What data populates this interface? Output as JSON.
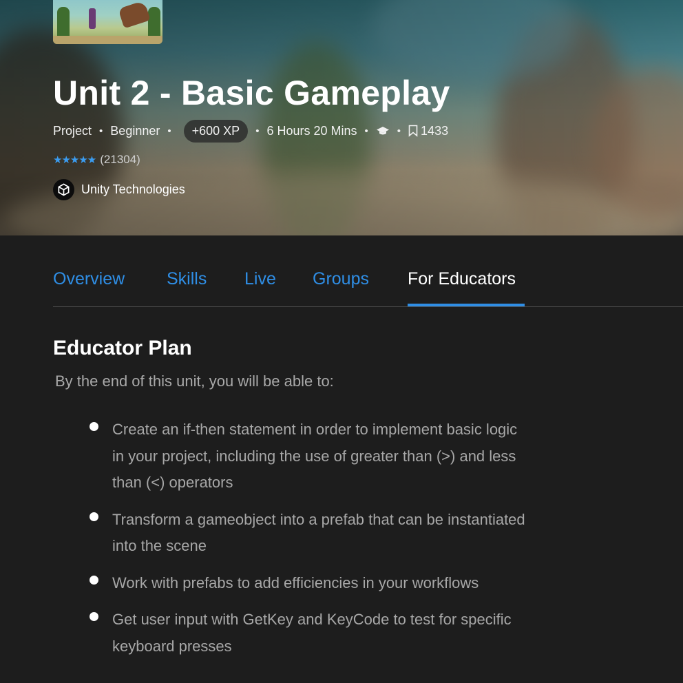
{
  "hero": {
    "title": "Unit 2 - Basic Gameplay",
    "meta": {
      "type": "Project",
      "level": "Beginner",
      "xp": "+600 XP",
      "duration": "6 Hours 20 Mins",
      "educator_icon": "graduation-cap-icon",
      "bookmark_count": "1433"
    },
    "rating": {
      "stars": "★★★★★",
      "value": 4.5,
      "count": "(21304)"
    },
    "author": {
      "name": "Unity Technologies",
      "icon": "unity-logo-icon"
    }
  },
  "tabs": [
    {
      "label": "Overview",
      "active": false
    },
    {
      "label": "Skills",
      "active": false
    },
    {
      "label": "Live",
      "active": false
    },
    {
      "label": "Groups",
      "active": false
    },
    {
      "label": "For Educators",
      "active": true
    }
  ],
  "content": {
    "heading": "Educator Plan",
    "intro": "By the end of this unit, you will be able to:",
    "items": [
      "Create an if-then statement in order to implement basic logic in your project, including the use of greater than (>) and less than (<) operators",
      "Transform a gameobject into a prefab that can be instantiated into the scene",
      "Work with prefabs to add efficiencies in your workflows",
      "Get user input with GetKey and KeyCode to test for specific keyboard presses"
    ]
  },
  "colors": {
    "accent": "#2f8ee5",
    "background": "#1d1d1d",
    "star": "#3b9cf0"
  }
}
